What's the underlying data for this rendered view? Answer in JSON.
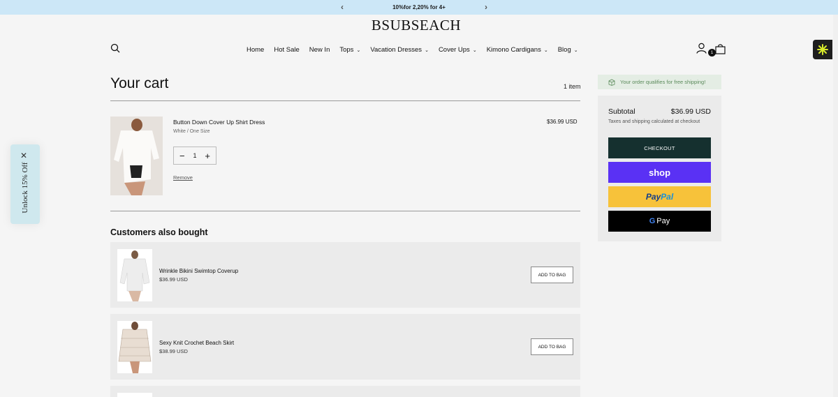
{
  "announcement": {
    "text": "10%for 2,20% for 4+",
    "prev": "‹",
    "next": "›"
  },
  "brand": {
    "logo": "BSUBSEACH"
  },
  "nav": {
    "items": [
      {
        "label": "Home",
        "has_dropdown": false
      },
      {
        "label": "Hot Sale",
        "has_dropdown": false
      },
      {
        "label": "New In",
        "has_dropdown": false
      },
      {
        "label": "Tops",
        "has_dropdown": true
      },
      {
        "label": "Vacation Dresses",
        "has_dropdown": true
      },
      {
        "label": "Cover Ups",
        "has_dropdown": true
      },
      {
        "label": "Kimono Cardigans",
        "has_dropdown": true
      },
      {
        "label": "Blog",
        "has_dropdown": true
      }
    ],
    "dropdown_glyph": "⌄"
  },
  "header_icons": {
    "search": "search-icon",
    "account": "user-icon",
    "bag": "bag-icon",
    "bag_count": "1"
  },
  "unlock_tab": {
    "label": "Unlock 15% Off",
    "close": "✕"
  },
  "cart": {
    "title": "Your cart",
    "item_count": "1 item",
    "line_item": {
      "name": "Button Down Cover Up Shirt Dress",
      "variant": "White / One Size",
      "price": "$36.99 USD",
      "quantity": "1",
      "minus": "−",
      "plus": "+",
      "remove": "Remove"
    }
  },
  "recommendations": {
    "heading": "Customers also bought",
    "items": [
      {
        "name": "Wrinkle Bikini Swimtop Coverup",
        "price": "$36.99 USD",
        "button": "ADD TO BAG"
      },
      {
        "name": "Sexy Knit Crochet Beach Skirt",
        "price": "$38.99 USD",
        "button": "ADD TO BAG"
      }
    ]
  },
  "summary": {
    "shipping_note": "Your order qualifies for free shipping!",
    "subtotal_label": "Subtotal",
    "subtotal_value": "$36.99 USD",
    "tax_note": "Taxes and shipping calculated at checkout",
    "checkout": "CHECKOUT",
    "shop_pay": "shop",
    "paypal_a": "Pay",
    "paypal_b": "Pal",
    "gpay_g": "G",
    "gpay_text": "Pay"
  },
  "colors": {
    "announce_bg": "#cce7f7",
    "checkout_bg": "#15302f",
    "shop_bg": "#5a31f4",
    "paypal_bg": "#f7c23a",
    "gpay_bg": "#000000"
  }
}
